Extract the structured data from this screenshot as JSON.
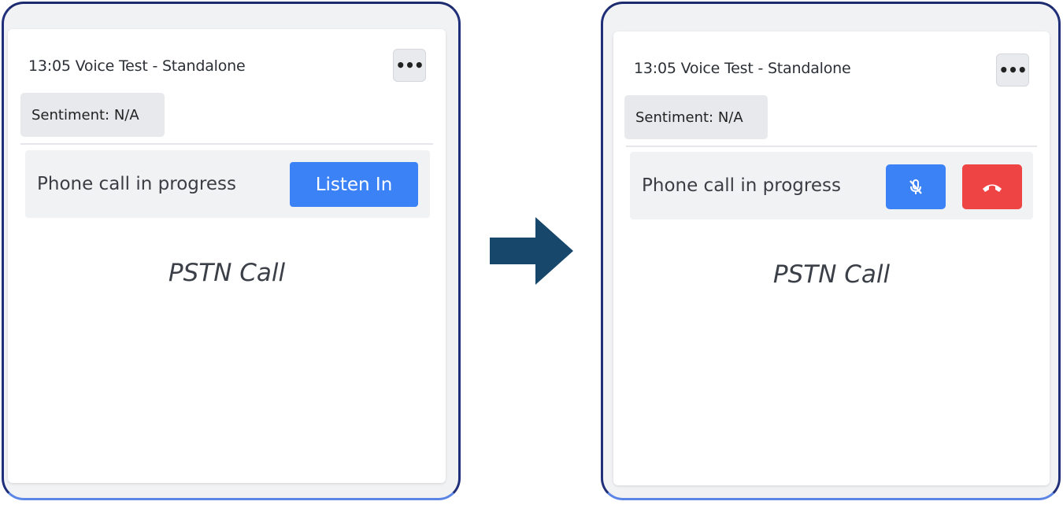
{
  "before": {
    "card_title": "13:05 Voice Test - Standalone",
    "more_label": "•••",
    "sentiment": "Sentiment: N/A",
    "status_text": "Phone call in progress",
    "listen_label": "Listen In",
    "call_type": "PSTN Call"
  },
  "after": {
    "card_title": "13:05 Voice Test - Standalone",
    "more_label": "•••",
    "sentiment": "Sentiment: N/A",
    "status_text": "Phone call in progress",
    "mute_icon": "microphone-off-icon",
    "hangup_icon": "phone-hangup-icon",
    "call_type": "PSTN Call"
  },
  "arrow_icon": "right-arrow-icon",
  "colors": {
    "accent_blue": "#3b82f6",
    "hangup_red": "#ef4444",
    "arrow": "#17476b",
    "frame_border": "#1f2f7a"
  }
}
